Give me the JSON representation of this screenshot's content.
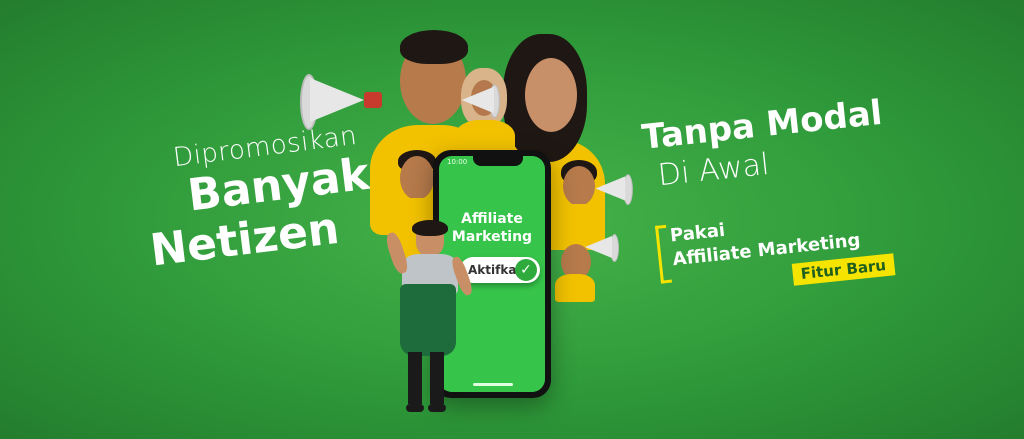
{
  "left_copy": {
    "line1": "Dipromosikan",
    "line2": "Banyak",
    "line3": "Netizen"
  },
  "right_copy": {
    "title_line1": "Tanpa Modal",
    "title_line2": "Di Awal",
    "feature_line1": "Pakai",
    "feature_line2": "Affiliate Marketing",
    "badge": "Fitur Baru"
  },
  "phone": {
    "statusbar_time": "10:00",
    "app_title_line1": "Affiliate",
    "app_title_line2": "Marketing",
    "toggle_label": "Aktifkan",
    "toggle_icon": "check-icon"
  },
  "colors": {
    "background": "#2f9a3a",
    "accent_yellow": "#f5e400",
    "screen_green": "#36c54a"
  }
}
